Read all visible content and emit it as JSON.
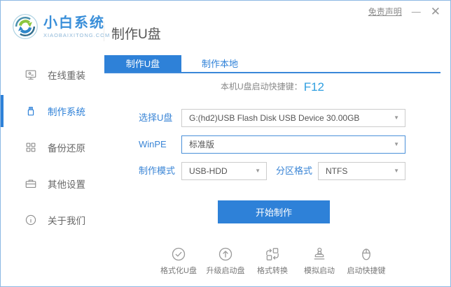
{
  "window": {
    "disclaimer": "免责声明",
    "minimize": "—",
    "close": "✕"
  },
  "header": {
    "logo_title": "小白系统",
    "logo_subtitle": "XIAOBAIXITONG.COM",
    "page_title": "制作U盘"
  },
  "sidebar": {
    "items": [
      {
        "label": "在线重装",
        "icon": "monitor-icon",
        "active": false
      },
      {
        "label": "制作系统",
        "icon": "usb-drive-icon",
        "active": true
      },
      {
        "label": "备份还原",
        "icon": "backup-grid-icon",
        "active": false
      },
      {
        "label": "其他设置",
        "icon": "briefcase-icon",
        "active": false
      },
      {
        "label": "关于我们",
        "icon": "info-icon",
        "active": false
      }
    ]
  },
  "tabs": [
    {
      "label": "制作U盘",
      "active": true
    },
    {
      "label": "制作本地",
      "active": false
    }
  ],
  "main": {
    "hotkey_label": "本机U盘启动快捷键：",
    "hotkey_value": "F12",
    "form": {
      "usb_label": "选择U盘",
      "usb_value": "G:(hd2)USB Flash Disk USB Device 30.00GB",
      "winpe_label": "WinPE",
      "winpe_value": "标准版",
      "mode_label": "制作模式",
      "mode_value": "USB-HDD",
      "partition_label": "分区格式",
      "partition_value": "NTFS"
    },
    "start_button": "开始制作",
    "footer_tools": [
      {
        "label": "格式化U盘",
        "icon": "format-usb-icon"
      },
      {
        "label": "升级启动盘",
        "icon": "upgrade-disk-icon"
      },
      {
        "label": "格式转换",
        "icon": "format-convert-icon"
      },
      {
        "label": "模拟启动",
        "icon": "simulate-boot-icon"
      },
      {
        "label": "启动快捷键",
        "icon": "boot-hotkey-icon"
      }
    ]
  },
  "colors": {
    "accent": "#2e81d8",
    "label_blue": "#3a85d6",
    "hotkey_blue": "#2f9fe0",
    "border_gray": "#cccccc",
    "window_border": "#8cb8e4",
    "logo_green": "#8cc63f",
    "logo_blue": "#2e86c8"
  }
}
